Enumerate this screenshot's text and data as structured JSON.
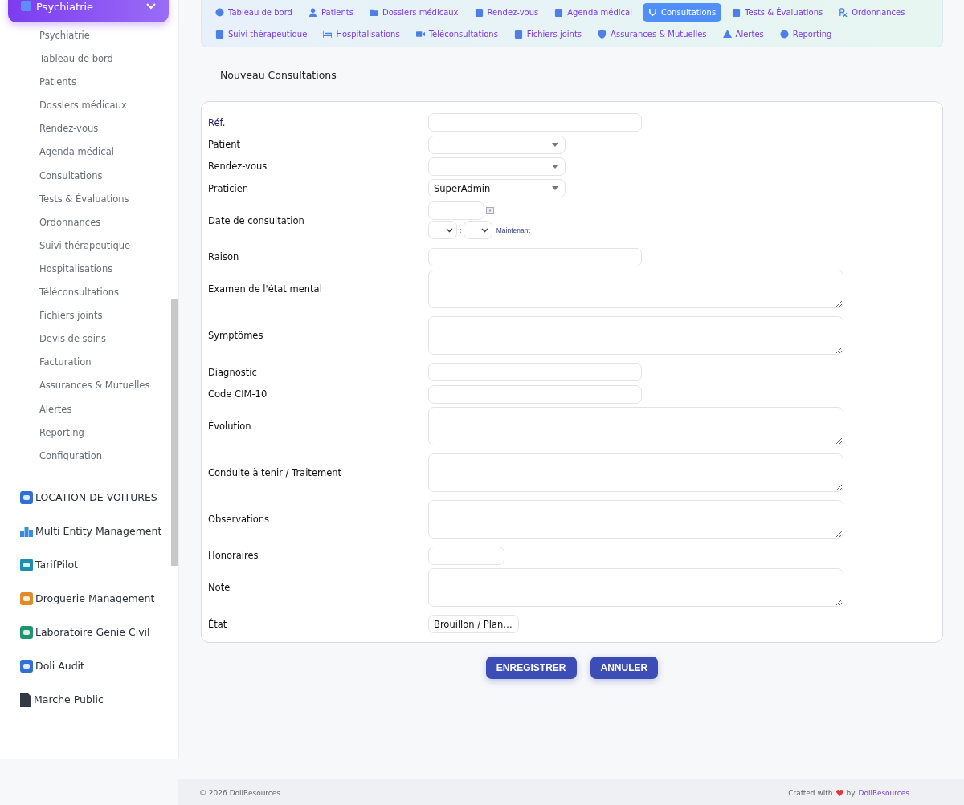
{
  "sidebar": {
    "group": {
      "title": "Psychiatrie",
      "expanded": true
    },
    "items": [
      {
        "label": "Psychiatrie"
      },
      {
        "label": "Tableau de bord"
      },
      {
        "label": "Patients"
      },
      {
        "label": "Dossiers médicaux"
      },
      {
        "label": "Rendez-vous"
      },
      {
        "label": "Agenda médical"
      },
      {
        "label": "Consultations"
      },
      {
        "label": "Tests & Évaluations"
      },
      {
        "label": "Ordonnances"
      },
      {
        "label": "Suivi thérapeutique"
      },
      {
        "label": "Hospitalisations"
      },
      {
        "label": "Téléconsultations"
      },
      {
        "label": "Fichiers joints"
      },
      {
        "label": "Devis de soins"
      },
      {
        "label": "Facturation"
      },
      {
        "label": "Assurances & Mutuelles"
      },
      {
        "label": "Alertes"
      },
      {
        "label": "Reporting"
      },
      {
        "label": "Configuration"
      }
    ],
    "modules": [
      {
        "label": "LOCATION DE VOITURES"
      },
      {
        "label": "Multi Entity Management"
      },
      {
        "label": "TarifPilot"
      },
      {
        "label": "Droguerie Management"
      },
      {
        "label": "Laboratoire Genie Civil"
      },
      {
        "label": "Doli Audit"
      },
      {
        "label": "Marche Public"
      }
    ]
  },
  "tabs": [
    {
      "label": "Tableau de bord",
      "selected": false
    },
    {
      "label": "Patients",
      "selected": false
    },
    {
      "label": "Dossiers médicaux",
      "selected": false
    },
    {
      "label": "Rendez-vous",
      "selected": false
    },
    {
      "label": "Agenda médical",
      "selected": false
    },
    {
      "label": "Consultations",
      "selected": true
    },
    {
      "label": "Tests & Évaluations",
      "selected": false
    },
    {
      "label": "Ordonnances",
      "selected": false
    },
    {
      "label": "Suivi thérapeutique",
      "selected": false
    },
    {
      "label": "Hospitalisations",
      "selected": false
    },
    {
      "label": "Téléconsultations",
      "selected": false
    },
    {
      "label": "Fichiers joints",
      "selected": false
    },
    {
      "label": "Assurances & Mutuelles",
      "selected": false
    },
    {
      "label": "Alertes",
      "selected": false
    },
    {
      "label": "Reporting",
      "selected": false
    }
  ],
  "page_title": "Nouveau Consultations",
  "form": [
    {
      "label": "Réf.",
      "kind": "text",
      "required": true
    },
    {
      "label": "Patient",
      "kind": "select",
      "required": false
    },
    {
      "label": "Rendez-vous",
      "kind": "select",
      "required": false
    },
    {
      "label": "Praticien",
      "kind": "select",
      "value": "SuperAdmin",
      "required": false
    },
    {
      "label": "Date de consultation",
      "kind": "datetime",
      "separator": ":",
      "now_link": "Maintenant",
      "required": false
    },
    {
      "label": "Raison",
      "kind": "text",
      "required": false
    },
    {
      "label": "Examen de l'état mental",
      "kind": "textarea",
      "required": false
    },
    {
      "label": "Symptômes",
      "kind": "textarea",
      "required": false
    },
    {
      "label": "Diagnostic",
      "kind": "text",
      "required": false
    },
    {
      "label": "Code CIM-10",
      "kind": "text",
      "required": false
    },
    {
      "label": "Évolution",
      "kind": "textarea",
      "required": false
    },
    {
      "label": "Conduite à tenir / Traitement",
      "kind": "textarea",
      "required": false
    },
    {
      "label": "Observations",
      "kind": "textarea",
      "required": false
    },
    {
      "label": "Honoraires",
      "kind": "number",
      "required": false
    },
    {
      "label": "Note",
      "kind": "textarea",
      "required": false
    },
    {
      "label": "État",
      "kind": "status",
      "value": "Brouillon / Plan…",
      "required": false
    }
  ],
  "buttons": [
    "ENREGISTRER",
    "ANNULER"
  ],
  "footer": {
    "copyright": "© 2026 DoliResources",
    "crafted": "Crafted with",
    "by": "by",
    "brand": "DoliResources"
  }
}
